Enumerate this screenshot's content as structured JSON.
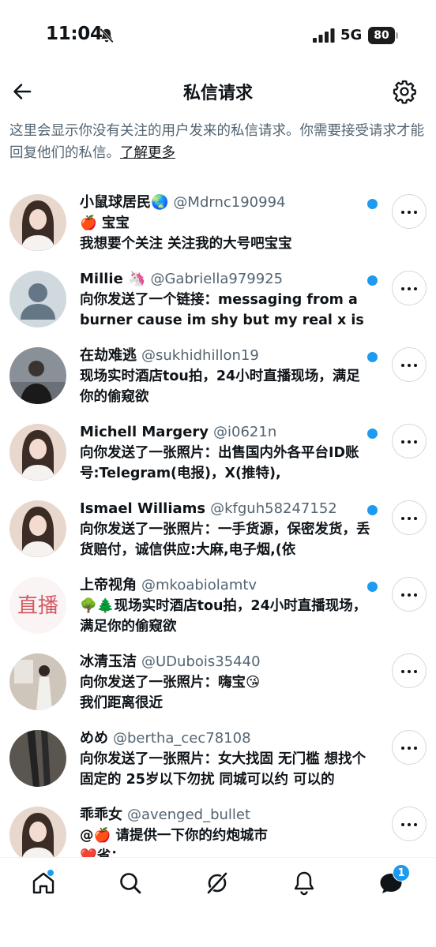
{
  "status_bar": {
    "time": "11:04",
    "network": "5G",
    "battery": "80"
  },
  "header": {
    "title": "私信请求"
  },
  "info": {
    "text": "这里会显示你没有关注的用户发来的私信请求。你需要接受请求才能回复他们的私信。",
    "link": "了解更多"
  },
  "requests": [
    {
      "name": "小鼠球居民🌏",
      "handle": "@Mdrnc190994",
      "preview": "🍎 宝宝\n我想要个关注 关注我的大号吧宝宝",
      "unread": true,
      "avatar": "photo-girl"
    },
    {
      "name": "Millie 🦄",
      "handle": "@Gabriella979925",
      "preview": "向你发送了一个链接：messaging from a burner cause im shy but my real x is",
      "unread": true,
      "avatar": "default-user"
    },
    {
      "name": "在劫难逃",
      "handle": "@sukhidhillon19",
      "preview": "现场实时酒店tou拍，24小时直播现场，满足你的偷窥欲",
      "unread": true,
      "avatar": "photo-man"
    },
    {
      "name": "Michell Margery",
      "handle": "@i0621n",
      "preview": "向你发送了一张照片：出售国内外各平台ID账号:Telegram(电报)，X(推特),",
      "unread": true,
      "avatar": "photo-girl"
    },
    {
      "name": "Ismael Williams",
      "handle": "@kfguh58247152",
      "preview": "向你发送了一张照片：一手货源，保密发货，丢货赔付，诚信供应:大麻,电子烟,(依",
      "unread": true,
      "avatar": "photo-girl"
    },
    {
      "name": "上帝视角",
      "handle": "@mkoabiolamtv",
      "preview": "🌳🌲现场实时酒店tou拍，24小时直播现场，满足你的偷窥欲",
      "unread": true,
      "avatar": "live-text",
      "avatar_text": "直播"
    },
    {
      "name": "冰清玉洁",
      "handle": "@UDubois35440",
      "preview": "向你发送了一张照片：嗨宝😘\n我们距离很近",
      "unread": false,
      "avatar": "photo-room"
    },
    {
      "name": "めめ",
      "handle": "@bertha_cec78108",
      "preview": "向你发送了一张照片：女大找固 无门槛 想找个固定的 25岁以下勿扰 同城可以约 可以的",
      "unread": false,
      "avatar": "photo-legs"
    },
    {
      "name": "乖乖女",
      "handle": "@avenged_bullet",
      "preview": "@🍎 请提供一下你的约炮城市\n❤️省：",
      "unread": false,
      "avatar": "photo-girl"
    }
  ],
  "bottom_nav": {
    "items": [
      "home",
      "search",
      "grok",
      "notifications",
      "messages"
    ],
    "messages_badge": "1"
  },
  "colors": {
    "accent": "#1d9bf0",
    "text": "#0f1419",
    "muted": "#536471"
  }
}
